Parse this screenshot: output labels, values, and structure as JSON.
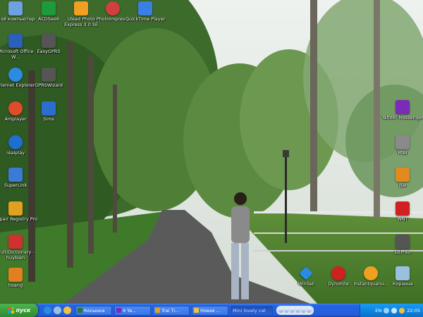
{
  "desktop": {
    "left_icons": [
      {
        "label": "Мой компьютер",
        "color": "#6fa0e0"
      },
      {
        "label": "Microsoft Office W...",
        "color": "#2b5fb8"
      },
      {
        "label": "Internet Explorer",
        "color": "#2a8be0"
      },
      {
        "label": "Amplayer",
        "color": "#e04b2b"
      },
      {
        "label": "realplay",
        "color": "#1f6fd0"
      },
      {
        "label": "SuperLink",
        "color": "#3a7bd5"
      },
      {
        "label": "Repair Registry Pro",
        "color": "#e0a020"
      },
      {
        "label": "MultiDictionary - huybien",
        "color": "#d03030"
      },
      {
        "label": "hoang",
        "color": "#e08020"
      }
    ],
    "second_column_icons": [
      {
        "label": "ACDSee6",
        "color": "#1f9a3a"
      },
      {
        "label": "EasyGPRS",
        "color": "#555555"
      },
      {
        "label": "GPRSWizard",
        "color": "#555555"
      },
      {
        "label": "Sims",
        "color": "#2a6fd0"
      }
    ],
    "top_icons": [
      {
        "label": "Ulead Photo Express 3.0 SE",
        "color": "#f0a020"
      },
      {
        "label": "PhotoImpres...",
        "color": "#d04040"
      },
      {
        "label": "QuickTime Player",
        "color": "#3a80e0"
      }
    ],
    "right_icons": [
      {
        "label": "Yahoo! Messenger",
        "color": "#7a2bb8"
      },
      {
        "label": "Mail",
        "color": "#8a8a8a"
      },
      {
        "label": "Bài",
        "color": "#e08a20"
      },
      {
        "label": "WNT",
        "color": "#d02020"
      },
      {
        "label": "Lịch sử",
        "color": "#555555"
      }
    ],
    "bottom_icons": [
      {
        "label": "WinSet",
        "color": "#2a8be0"
      },
      {
        "label": "Dynohite",
        "color": "#d02020"
      },
      {
        "label": "Instantquanu...",
        "color": "#f0a020"
      },
      {
        "label": "Корзина",
        "color": "#9ac0e0"
      }
    ]
  },
  "taskbar": {
    "start_label": "пуск",
    "tasks": [
      {
        "label": "Косынка",
        "color": "#2a7a2a",
        "active": false
      },
      {
        "label": "4 Ya...",
        "color": "#7a2bb8",
        "active": false
      },
      {
        "label": "Trai Ti...",
        "color": "#e0a020",
        "active": false
      },
      {
        "label": "Новая ...",
        "color": "#f0c040",
        "active": false
      },
      {
        "label": "Mini lovely cat",
        "color": "#2a6fd0",
        "active": true
      }
    ],
    "language": "EN",
    "clock": "22:05"
  },
  "colors": {
    "taskbar_blue": "#245edb",
    "start_green": "#3c9f3c",
    "tray_blue": "#0f86e0"
  }
}
